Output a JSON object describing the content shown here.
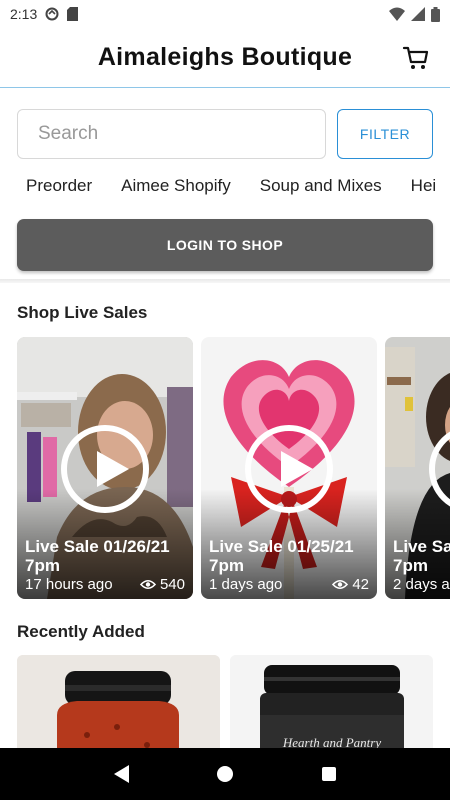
{
  "status_bar": {
    "time": "2:13",
    "icons": [
      "sync-icon",
      "sd-card-icon",
      "wifi-icon",
      "signal-icon",
      "battery-icon"
    ]
  },
  "header": {
    "title": "Aimaleighs Boutique",
    "cart_icon": "cart-icon"
  },
  "search": {
    "placeholder": "Search",
    "value": "",
    "filter_label": "FILTER"
  },
  "categories": [
    "Preorder",
    "Aimee Shopify",
    "Soup and Mixes",
    "Hei"
  ],
  "login": {
    "label": "LOGIN TO SHOP"
  },
  "live_section": {
    "title": "Shop Live Sales",
    "cards": [
      {
        "title": "Live Sale 01/26/21\n7pm",
        "time_ago": "17 hours ago",
        "views": "540"
      },
      {
        "title": "Live Sale 01/25/21\n7pm",
        "time_ago": "1 days ago",
        "views": "42"
      },
      {
        "title": "Live Sa\n7pm",
        "time_ago": "2 days a",
        "views": ""
      }
    ]
  },
  "recent_section": {
    "title": "Recently Added",
    "product_label": "Hearth and Pantry"
  },
  "colors": {
    "accent": "#2a8fd6",
    "login_bg": "#5c5c5c",
    "header_border": "#8ec6e8"
  }
}
